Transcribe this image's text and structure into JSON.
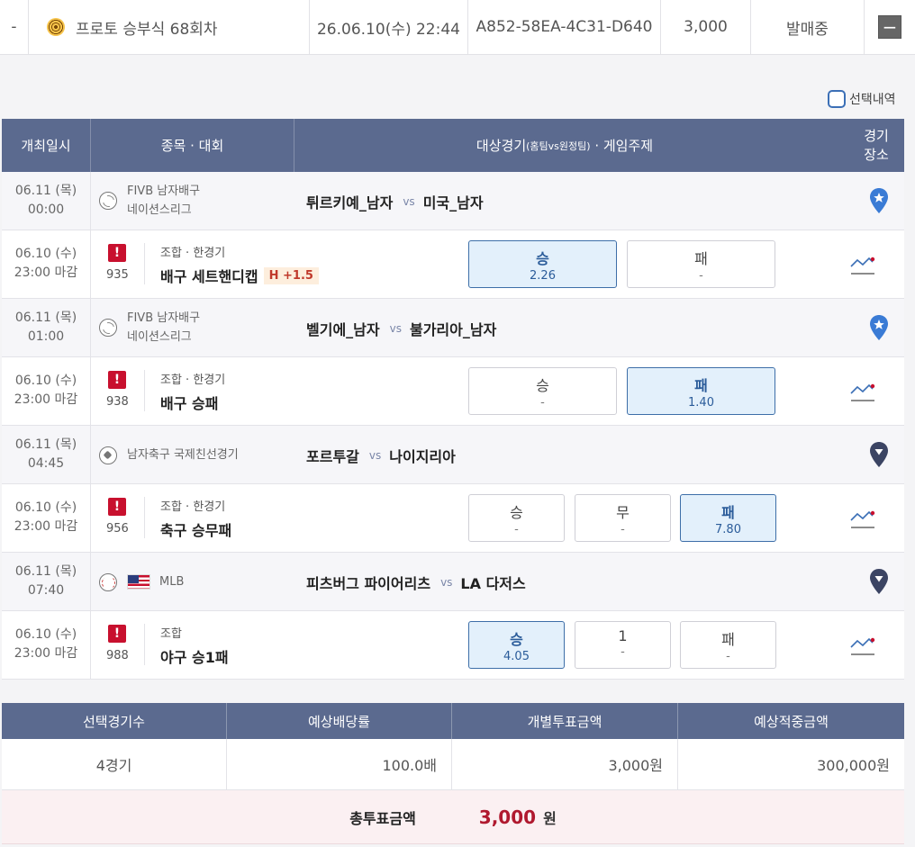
{
  "top_row": {
    "dash": "-",
    "title": "프로토 승부식 68회차",
    "datetime": "26.06.10(수) 22:44",
    "ticket_id": "A852-58EA-4C31-D640",
    "amount": "3,000",
    "status": "발매중",
    "collapse_label": "−"
  },
  "select_history": {
    "label": "선택내역"
  },
  "table": {
    "headers": {
      "date": "개최일시",
      "sport": "종목 · 대회",
      "target_main": "대상경기",
      "target_sub": "(홈팀vs원정팀)",
      "target_tail": " · 게임주제",
      "venue": "경기\n장소"
    },
    "games": [
      {
        "date": "06.11 (목)",
        "time": "00:00",
        "sport_icon": "volleyball-icon",
        "league_line1": "FIVB 남자배구",
        "league_line2": "네이션스리그",
        "home": "튀르키예_남자",
        "vs": "vs",
        "away": "미국_남자",
        "venue_icon": "home-pin-icon",
        "bet": {
          "date": "06.10 (수)",
          "deadline": "23:00 마감",
          "game_no": "935",
          "bet_type": "조합 · 한경기",
          "bet_name": "배구 세트핸디캡",
          "handicap": "H +1.5",
          "options": [
            {
              "label": "승",
              "odds": "2.26",
              "selected": true
            },
            {
              "label": "패",
              "odds": "-",
              "selected": false
            }
          ]
        }
      },
      {
        "date": "06.11 (목)",
        "time": "01:00",
        "sport_icon": "volleyball-icon",
        "league_line1": "FIVB 남자배구",
        "league_line2": "네이션스리그",
        "home": "벨기에_남자",
        "vs": "vs",
        "away": "불가리아_남자",
        "venue_icon": "home-pin-icon",
        "bet": {
          "date": "06.10 (수)",
          "deadline": "23:00 마감",
          "game_no": "938",
          "bet_type": "조합 · 한경기",
          "bet_name": "배구 승패",
          "handicap": "",
          "options": [
            {
              "label": "승",
              "odds": "-",
              "selected": false
            },
            {
              "label": "패",
              "odds": "1.40",
              "selected": true
            }
          ]
        }
      },
      {
        "date": "06.11 (목)",
        "time": "04:45",
        "sport_icon": "soccer-ball-icon",
        "league_line1": "남자축구 국제친선경기",
        "league_line2": "",
        "home": "포르투갈",
        "vs": "vs",
        "away": "나이지리아",
        "venue_icon": "neutral-pin-icon",
        "bet": {
          "date": "06.10 (수)",
          "deadline": "23:00 마감",
          "game_no": "956",
          "bet_type": "조합 · 한경기",
          "bet_name": "축구 승무패",
          "handicap": "",
          "options": [
            {
              "label": "승",
              "odds": "-",
              "selected": false
            },
            {
              "label": "무",
              "odds": "-",
              "selected": false
            },
            {
              "label": "패",
              "odds": "7.80",
              "selected": true
            }
          ]
        }
      },
      {
        "date": "06.11 (목)",
        "time": "07:40",
        "sport_icon": "baseball-icon",
        "league_line1": "MLB",
        "league_line2": "",
        "flag": "us-flag-icon",
        "home": "피츠버그 파이어리츠",
        "vs": "vs",
        "away": "LA 다저스",
        "venue_icon": "neutral-pin-icon",
        "bet": {
          "date": "06.10 (수)",
          "deadline": "23:00 마감",
          "game_no": "988",
          "bet_type": "조합",
          "bet_name": "야구 승1패",
          "handicap": "",
          "options": [
            {
              "label": "승",
              "odds": "4.05",
              "selected": true
            },
            {
              "label": "1",
              "odds": "-",
              "selected": false
            },
            {
              "label": "패",
              "odds": "-",
              "selected": false
            }
          ]
        }
      }
    ]
  },
  "summary": {
    "headers": [
      "선택경기수",
      "예상배당률",
      "개별투표금액",
      "예상적중금액"
    ],
    "values": [
      "4경기",
      "100.0배",
      "3,000원",
      "300,000원"
    ],
    "total_label": "총투표금액",
    "total_value": "3,000",
    "total_unit": "원"
  },
  "colors": {
    "header_bg": "#5b6a8f",
    "selected_bg": "#e3f0fb",
    "selected_border": "#3d6ea8",
    "alert_red": "#c8102e",
    "total_red": "#b0192f",
    "home_pin": "#3a7bd5",
    "neutral_pin": "#3b4463"
  }
}
